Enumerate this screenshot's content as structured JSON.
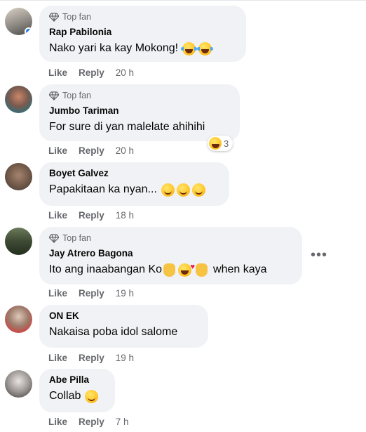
{
  "ui": {
    "top_fan": "Top fan",
    "like": "Like",
    "reply": "Reply"
  },
  "comments": [
    {
      "author": "Rap Pabilonia",
      "top_fan": true,
      "text": "Nako yari ka kay Mokong!",
      "time": "20 h"
    },
    {
      "author": "Jumbo Tariman",
      "top_fan": true,
      "text": "For sure di yan malelate ahihihi",
      "time": "20 h",
      "reaction_count": "3"
    },
    {
      "author": "Boyet Galvez",
      "top_fan": false,
      "text": "Papakitaan ka nyan...",
      "time": "18 h"
    },
    {
      "author": "Jay Atrero Bagona",
      "top_fan": true,
      "text_before": "Ito ang inaabangan Ko",
      "text_after": "when kaya",
      "time": "19 h"
    },
    {
      "author": "ON EK",
      "top_fan": false,
      "text": "Nakaisa poba idol salome",
      "time": "19 h"
    },
    {
      "author": "Abe Pilla",
      "top_fan": false,
      "text": "Collab",
      "time": "7 h"
    }
  ],
  "colors": {
    "bubble": "#f0f2f5",
    "meta": "#65676b",
    "text": "#050505"
  }
}
